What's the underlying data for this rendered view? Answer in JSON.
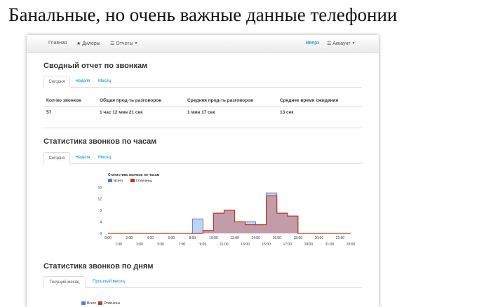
{
  "slide": {
    "title": "Банальные, но очень важные данные телефонии"
  },
  "navbar": {
    "home": "Главная",
    "dealers": "Дилеры",
    "dealers_icon": "star-icon",
    "reports": "Отчеты",
    "reports_icon": "list-icon",
    "up": "Вверх",
    "account": "Аккаунт",
    "account_icon": "list-icon"
  },
  "summary": {
    "title": "Сводный отчет по звонкам",
    "tabs": [
      "Сегодня",
      "Неделя",
      "Месяц"
    ],
    "active_tab": 0,
    "headers": [
      "Кол-во звонков",
      "Общая прод-ть разговоров",
      "Средняя прод-ть разговоров",
      "Среднее время ожидания"
    ],
    "values": [
      "57",
      "1 час 12 мин 21 сек",
      "1 мин 17 сек",
      "13 сек"
    ]
  },
  "hourly": {
    "title": "Статистика звонков по часам",
    "tabs": [
      "Сегодня",
      "Неделя",
      "Месяц"
    ],
    "active_tab": 0
  },
  "daily": {
    "title": "Статистика звонков по дням",
    "tabs": [
      "Текущий месяц",
      "Прошлый месяц"
    ],
    "active_tab": 0,
    "legend": [
      "Всего",
      "Отвечены"
    ]
  },
  "colors": {
    "total": "#4f7fd6",
    "answered": "#c23b22",
    "link": "#0088cc"
  },
  "chart_data": {
    "type": "area",
    "title": "Статистика звонков по часам",
    "ylim": [
      0,
      16
    ],
    "yticks": [
      "0",
      "4",
      "8",
      "12",
      "16"
    ],
    "xticks_top": [
      "0:00",
      "2:00",
      "4:00",
      "6:00",
      "8:00",
      "10:00",
      "12:00",
      "14:00",
      "16:00",
      "18:00",
      "20:00",
      "22:00"
    ],
    "xticks_bottom": [
      "1:00",
      "3:00",
      "5:00",
      "7:00",
      "9:00",
      "11:00",
      "13:00",
      "15:00",
      "17:00",
      "19:00",
      "21:00",
      "23:00"
    ],
    "categories": [
      "0:00",
      "1:00",
      "2:00",
      "3:00",
      "4:00",
      "5:00",
      "6:00",
      "7:00",
      "8:00",
      "9:00",
      "10:00",
      "11:00",
      "12:00",
      "13:00",
      "14:00",
      "15:00",
      "16:00",
      "17:00",
      "18:00",
      "19:00",
      "20:00",
      "21:00",
      "22:00",
      "23:00"
    ],
    "series": [
      {
        "name": "Всего",
        "values": [
          0,
          0,
          0,
          0,
          0,
          0,
          0,
          0,
          5,
          1,
          7,
          8,
          4,
          4,
          3,
          14,
          7,
          6,
          0,
          0,
          0,
          0,
          0,
          0
        ]
      },
      {
        "name": "Отвечены",
        "values": [
          0,
          0,
          0,
          0,
          0,
          0,
          0,
          0,
          0,
          1,
          7,
          8,
          4,
          3,
          3,
          13,
          7,
          6,
          0,
          0,
          0,
          0,
          0,
          0
        ]
      }
    ],
    "legend_placement": "top-left",
    "grid": false
  }
}
